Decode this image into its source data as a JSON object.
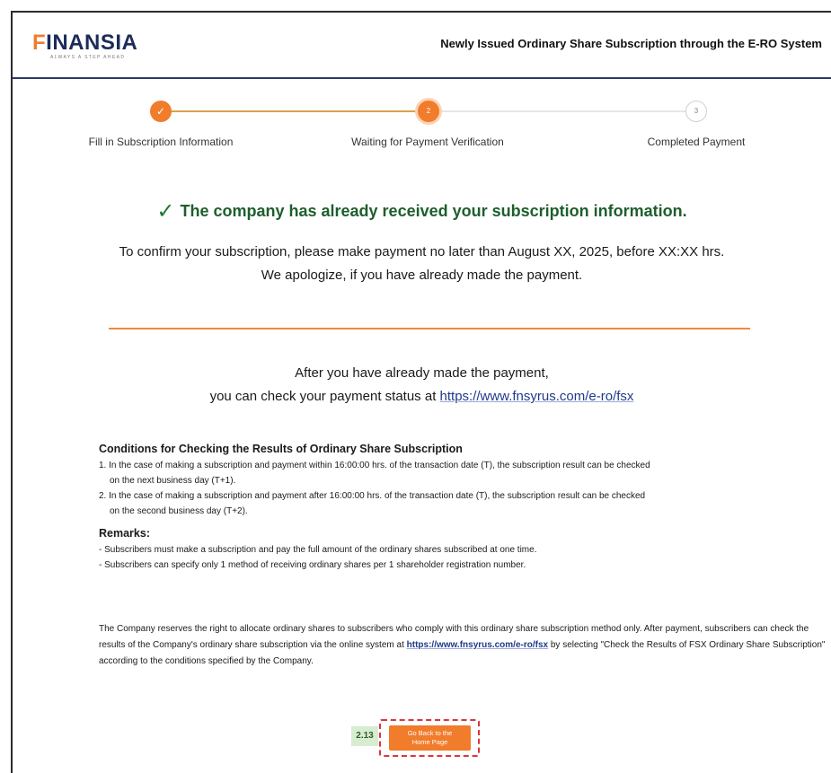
{
  "header": {
    "logo_prefix": "F",
    "logo_rest": "INANSIA",
    "logo_tagline": "ALWAYS A STEP AHEAD",
    "title": "Newly Issued Ordinary Share Subscription through the E-RO System"
  },
  "stepper": {
    "steps": [
      {
        "label": "Fill in Subscription Information",
        "status": "done",
        "marker": "✓"
      },
      {
        "label": "Waiting for Payment Verification",
        "status": "current",
        "marker": "2"
      },
      {
        "label": "Completed Payment",
        "status": "pending",
        "marker": "3"
      }
    ]
  },
  "confirmation": {
    "check_icon": "✓",
    "title": "The company has already received your subscription information.",
    "line1": "To confirm your subscription, please make payment no later than August XX, 2025, before XX:XX hrs.",
    "line2": "We apologize, if you have already made the payment."
  },
  "after_payment": {
    "line1": "After you have already made the payment,",
    "line2_prefix": "you can check your payment status at ",
    "link": "https://www.fnsyrus.com/e-ro/fsx"
  },
  "conditions": {
    "heading": "Conditions for Checking the Results of Ordinary Share Subscription",
    "items": [
      {
        "line_a": "1. In the case of making a subscription and payment within 16:00:00 hrs. of the transaction date (T), the subscription result can be checked",
        "line_b": "on the next business day (T+1)."
      },
      {
        "line_a": "2. In the case of making a subscription and payment after 16:00:00 hrs. of the transaction date (T), the subscription result can be checked",
        "line_b": "on the second business day (T+2)."
      }
    ]
  },
  "remarks": {
    "heading": "Remarks:",
    "items": [
      "- Subscribers must make a subscription and pay the full amount of the ordinary shares subscribed at one time.",
      "- Subscribers can specify only 1 method of receiving ordinary shares per 1 shareholder registration number."
    ]
  },
  "company_note": {
    "text_before": "The Company reserves the right to allocate ordinary shares to subscribers who comply with this ordinary share subscription method only. After payment, subscribers can check the results of the Company's ordinary share subscription via the online system at ",
    "link": "https://www.fnsyrus.com/e-ro/fsx",
    "text_after": " by selecting \"Check the Results of FSX Ordinary Share Subscription\" according to the conditions specified by the Company."
  },
  "footer": {
    "step_badge": "2.13",
    "home_button": "Go Back to the Home Page"
  },
  "colors": {
    "accent": "#f07c2c",
    "navy": "#1c2b5a",
    "success": "#1d5e2c",
    "link": "#1f3a8a"
  }
}
